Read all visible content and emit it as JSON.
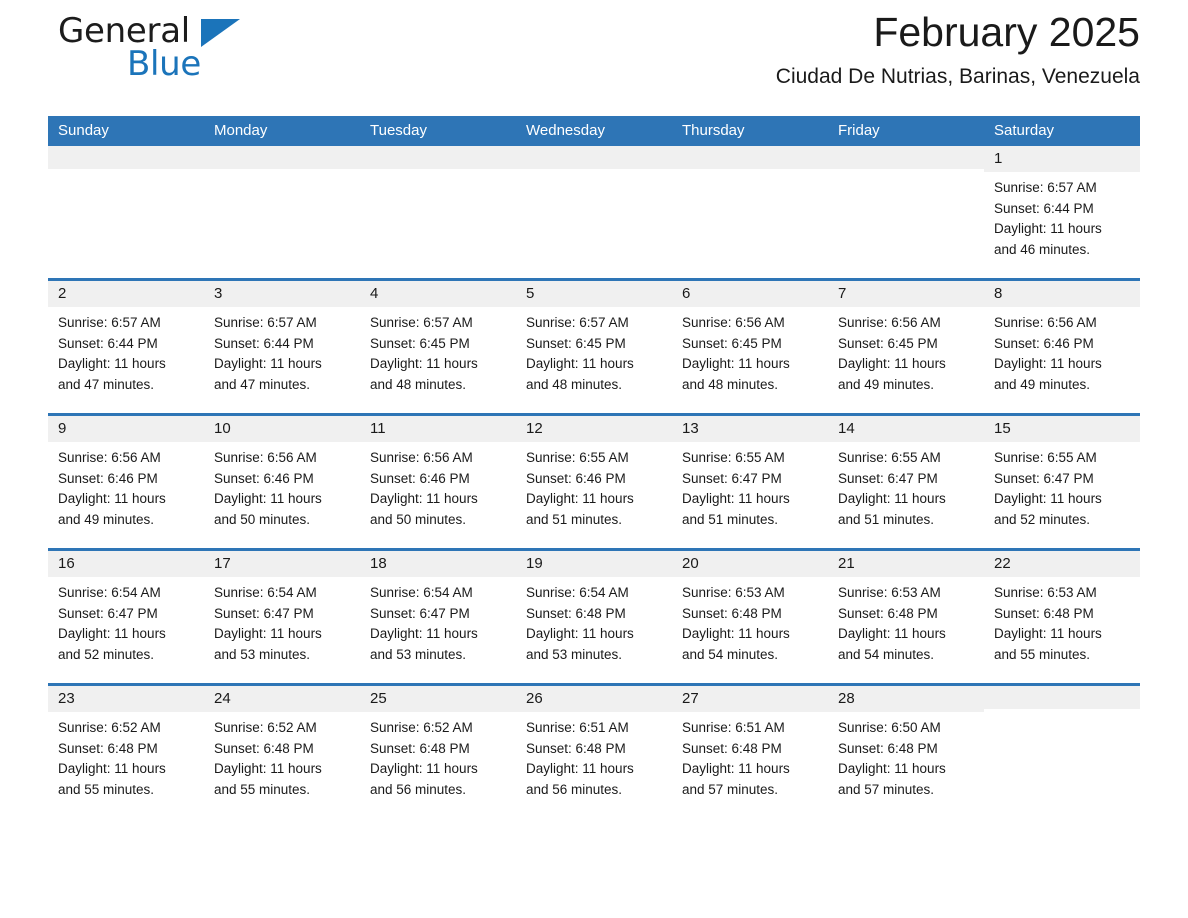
{
  "brand": {
    "name_part1": "General",
    "name_part2": "Blue",
    "triangle_icon": "brand-triangle-icon",
    "accent_color": "#1b74ba"
  },
  "header": {
    "month_title": "February 2025",
    "location": "Ciudad De Nutrias, Barinas, Venezuela"
  },
  "colors": {
    "header_blue": "#2e75b6",
    "row_separator": "#2e75b6",
    "daynum_band": "#f0f0f0",
    "text": "#1a1a1a"
  },
  "weekday_headers": [
    "Sunday",
    "Monday",
    "Tuesday",
    "Wednesday",
    "Thursday",
    "Friday",
    "Saturday"
  ],
  "weeks": [
    [
      {
        "day": "",
        "empty": true,
        "sunrise": "",
        "sunset": "",
        "daylight_line1": "",
        "daylight_line2": ""
      },
      {
        "day": "",
        "empty": true,
        "sunrise": "",
        "sunset": "",
        "daylight_line1": "",
        "daylight_line2": ""
      },
      {
        "day": "",
        "empty": true,
        "sunrise": "",
        "sunset": "",
        "daylight_line1": "",
        "daylight_line2": ""
      },
      {
        "day": "",
        "empty": true,
        "sunrise": "",
        "sunset": "",
        "daylight_line1": "",
        "daylight_line2": ""
      },
      {
        "day": "",
        "empty": true,
        "sunrise": "",
        "sunset": "",
        "daylight_line1": "",
        "daylight_line2": ""
      },
      {
        "day": "",
        "empty": true,
        "sunrise": "",
        "sunset": "",
        "daylight_line1": "",
        "daylight_line2": ""
      },
      {
        "day": "1",
        "empty": false,
        "sunrise": "Sunrise: 6:57 AM",
        "sunset": "Sunset: 6:44 PM",
        "daylight_line1": "Daylight: 11 hours",
        "daylight_line2": "and 46 minutes."
      }
    ],
    [
      {
        "day": "2",
        "empty": false,
        "sunrise": "Sunrise: 6:57 AM",
        "sunset": "Sunset: 6:44 PM",
        "daylight_line1": "Daylight: 11 hours",
        "daylight_line2": "and 47 minutes."
      },
      {
        "day": "3",
        "empty": false,
        "sunrise": "Sunrise: 6:57 AM",
        "sunset": "Sunset: 6:44 PM",
        "daylight_line1": "Daylight: 11 hours",
        "daylight_line2": "and 47 minutes."
      },
      {
        "day": "4",
        "empty": false,
        "sunrise": "Sunrise: 6:57 AM",
        "sunset": "Sunset: 6:45 PM",
        "daylight_line1": "Daylight: 11 hours",
        "daylight_line2": "and 48 minutes."
      },
      {
        "day": "5",
        "empty": false,
        "sunrise": "Sunrise: 6:57 AM",
        "sunset": "Sunset: 6:45 PM",
        "daylight_line1": "Daylight: 11 hours",
        "daylight_line2": "and 48 minutes."
      },
      {
        "day": "6",
        "empty": false,
        "sunrise": "Sunrise: 6:56 AM",
        "sunset": "Sunset: 6:45 PM",
        "daylight_line1": "Daylight: 11 hours",
        "daylight_line2": "and 48 minutes."
      },
      {
        "day": "7",
        "empty": false,
        "sunrise": "Sunrise: 6:56 AM",
        "sunset": "Sunset: 6:45 PM",
        "daylight_line1": "Daylight: 11 hours",
        "daylight_line2": "and 49 minutes."
      },
      {
        "day": "8",
        "empty": false,
        "sunrise": "Sunrise: 6:56 AM",
        "sunset": "Sunset: 6:46 PM",
        "daylight_line1": "Daylight: 11 hours",
        "daylight_line2": "and 49 minutes."
      }
    ],
    [
      {
        "day": "9",
        "empty": false,
        "sunrise": "Sunrise: 6:56 AM",
        "sunset": "Sunset: 6:46 PM",
        "daylight_line1": "Daylight: 11 hours",
        "daylight_line2": "and 49 minutes."
      },
      {
        "day": "10",
        "empty": false,
        "sunrise": "Sunrise: 6:56 AM",
        "sunset": "Sunset: 6:46 PM",
        "daylight_line1": "Daylight: 11 hours",
        "daylight_line2": "and 50 minutes."
      },
      {
        "day": "11",
        "empty": false,
        "sunrise": "Sunrise: 6:56 AM",
        "sunset": "Sunset: 6:46 PM",
        "daylight_line1": "Daylight: 11 hours",
        "daylight_line2": "and 50 minutes."
      },
      {
        "day": "12",
        "empty": false,
        "sunrise": "Sunrise: 6:55 AM",
        "sunset": "Sunset: 6:46 PM",
        "daylight_line1": "Daylight: 11 hours",
        "daylight_line2": "and 51 minutes."
      },
      {
        "day": "13",
        "empty": false,
        "sunrise": "Sunrise: 6:55 AM",
        "sunset": "Sunset: 6:47 PM",
        "daylight_line1": "Daylight: 11 hours",
        "daylight_line2": "and 51 minutes."
      },
      {
        "day": "14",
        "empty": false,
        "sunrise": "Sunrise: 6:55 AM",
        "sunset": "Sunset: 6:47 PM",
        "daylight_line1": "Daylight: 11 hours",
        "daylight_line2": "and 51 minutes."
      },
      {
        "day": "15",
        "empty": false,
        "sunrise": "Sunrise: 6:55 AM",
        "sunset": "Sunset: 6:47 PM",
        "daylight_line1": "Daylight: 11 hours",
        "daylight_line2": "and 52 minutes."
      }
    ],
    [
      {
        "day": "16",
        "empty": false,
        "sunrise": "Sunrise: 6:54 AM",
        "sunset": "Sunset: 6:47 PM",
        "daylight_line1": "Daylight: 11 hours",
        "daylight_line2": "and 52 minutes."
      },
      {
        "day": "17",
        "empty": false,
        "sunrise": "Sunrise: 6:54 AM",
        "sunset": "Sunset: 6:47 PM",
        "daylight_line1": "Daylight: 11 hours",
        "daylight_line2": "and 53 minutes."
      },
      {
        "day": "18",
        "empty": false,
        "sunrise": "Sunrise: 6:54 AM",
        "sunset": "Sunset: 6:47 PM",
        "daylight_line1": "Daylight: 11 hours",
        "daylight_line2": "and 53 minutes."
      },
      {
        "day": "19",
        "empty": false,
        "sunrise": "Sunrise: 6:54 AM",
        "sunset": "Sunset: 6:48 PM",
        "daylight_line1": "Daylight: 11 hours",
        "daylight_line2": "and 53 minutes."
      },
      {
        "day": "20",
        "empty": false,
        "sunrise": "Sunrise: 6:53 AM",
        "sunset": "Sunset: 6:48 PM",
        "daylight_line1": "Daylight: 11 hours",
        "daylight_line2": "and 54 minutes."
      },
      {
        "day": "21",
        "empty": false,
        "sunrise": "Sunrise: 6:53 AM",
        "sunset": "Sunset: 6:48 PM",
        "daylight_line1": "Daylight: 11 hours",
        "daylight_line2": "and 54 minutes."
      },
      {
        "day": "22",
        "empty": false,
        "sunrise": "Sunrise: 6:53 AM",
        "sunset": "Sunset: 6:48 PM",
        "daylight_line1": "Daylight: 11 hours",
        "daylight_line2": "and 55 minutes."
      }
    ],
    [
      {
        "day": "23",
        "empty": false,
        "sunrise": "Sunrise: 6:52 AM",
        "sunset": "Sunset: 6:48 PM",
        "daylight_line1": "Daylight: 11 hours",
        "daylight_line2": "and 55 minutes."
      },
      {
        "day": "24",
        "empty": false,
        "sunrise": "Sunrise: 6:52 AM",
        "sunset": "Sunset: 6:48 PM",
        "daylight_line1": "Daylight: 11 hours",
        "daylight_line2": "and 55 minutes."
      },
      {
        "day": "25",
        "empty": false,
        "sunrise": "Sunrise: 6:52 AM",
        "sunset": "Sunset: 6:48 PM",
        "daylight_line1": "Daylight: 11 hours",
        "daylight_line2": "and 56 minutes."
      },
      {
        "day": "26",
        "empty": false,
        "sunrise": "Sunrise: 6:51 AM",
        "sunset": "Sunset: 6:48 PM",
        "daylight_line1": "Daylight: 11 hours",
        "daylight_line2": "and 56 minutes."
      },
      {
        "day": "27",
        "empty": false,
        "sunrise": "Sunrise: 6:51 AM",
        "sunset": "Sunset: 6:48 PM",
        "daylight_line1": "Daylight: 11 hours",
        "daylight_line2": "and 57 minutes."
      },
      {
        "day": "28",
        "empty": false,
        "sunrise": "Sunrise: 6:50 AM",
        "sunset": "Sunset: 6:48 PM",
        "daylight_line1": "Daylight: 11 hours",
        "daylight_line2": "and 57 minutes."
      },
      {
        "day": "",
        "empty": true,
        "sunrise": "",
        "sunset": "",
        "daylight_line1": "",
        "daylight_line2": ""
      }
    ]
  ]
}
